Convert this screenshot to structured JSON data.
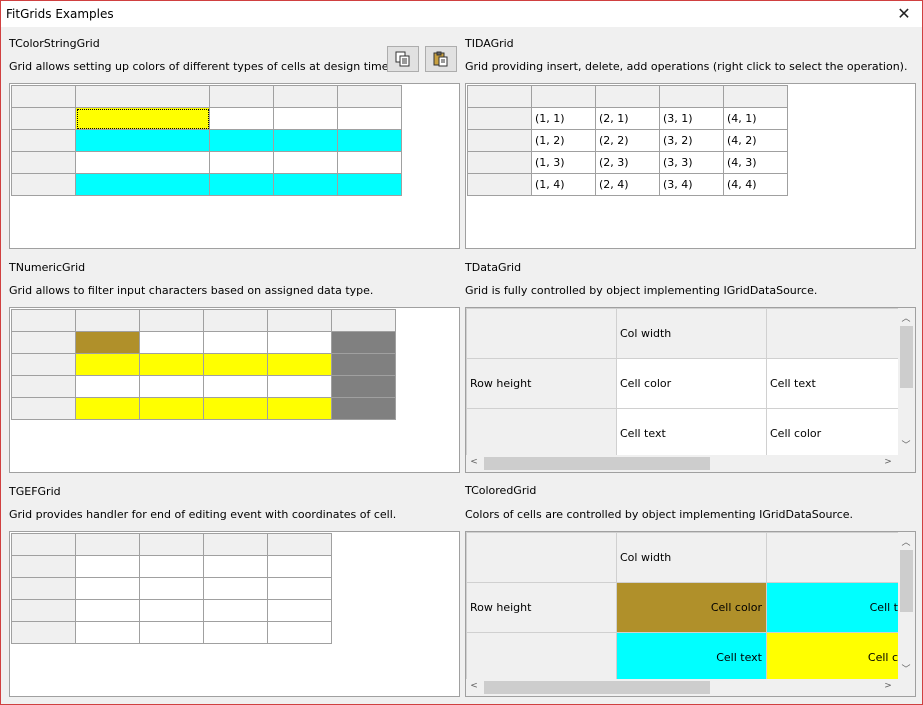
{
  "window": {
    "title": "FitGrids Examples"
  },
  "colorString": {
    "title": "TColorStringGrid",
    "desc": "Grid allows setting up colors of different types of cells at design time.",
    "colors": {
      "yellow": "#ffff00",
      "cyan": "#00ffff",
      "white": "#ffffff"
    }
  },
  "toolbar": {
    "copy_icon": "copy-icon",
    "paste_icon": "paste-icon"
  },
  "tida": {
    "title": "TIDAGrid",
    "desc": "Grid providing insert, delete, add operations (right click to select the operation).",
    "rows": [
      [
        "(1, 1)",
        "(2, 1)",
        "(3, 1)",
        "(4, 1)"
      ],
      [
        "(1, 2)",
        "(2, 2)",
        "(3, 2)",
        "(4, 2)"
      ],
      [
        "(1, 3)",
        "(2, 3)",
        "(3, 3)",
        "(4, 3)"
      ],
      [
        "(1, 4)",
        "(2, 4)",
        "(3, 4)",
        "(4, 4)"
      ]
    ]
  },
  "numeric": {
    "title": "TNumericGrid",
    "desc": "Grid allows to filter input characters based on assigned data type.",
    "colors": {
      "olive": "#b0902a",
      "yellow": "#ffff00",
      "gray": "#808080"
    }
  },
  "dataGrid": {
    "title": "TDataGrid",
    "desc": "Grid is fully controlled by object implementing IGridDataSource.",
    "col_width": "Col width",
    "row_height": "Row height",
    "cell_color": "Cell color",
    "cell_text": "Cell text"
  },
  "gef": {
    "title": "TGEFGrid",
    "desc": "Grid provides handler for end of editing event with coordinates of cell."
  },
  "colored": {
    "title": "TColoredGrid",
    "desc": "Colors of cells are controlled by object implementing IGridDataSource.",
    "col_width": "Col width",
    "row_height": "Row height",
    "cell_color": "Cell color",
    "cell_text": "Cell text",
    "cell_t_clipped": "Cell t",
    "cell_c_clipped": "Cell c",
    "colors": {
      "olive": "#b0902a",
      "cyan": "#00ffff",
      "yellow": "#ffff00"
    }
  }
}
